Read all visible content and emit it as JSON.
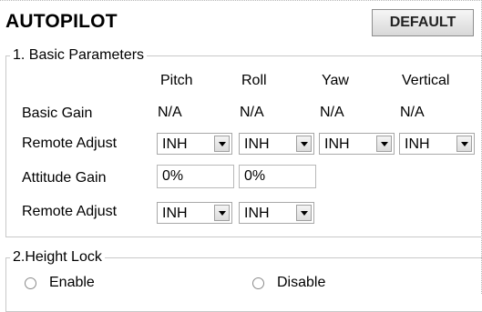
{
  "title": "AUTOPILOT",
  "default_label": "DEFAULT",
  "basic": {
    "legend": "1. Basic Parameters",
    "columns": [
      "Pitch",
      "Roll",
      "Yaw",
      "Vertical"
    ],
    "rows": {
      "basic_gain": {
        "label": "Basic Gain",
        "values": [
          "N/A",
          "N/A",
          "N/A",
          "N/A"
        ]
      },
      "remote_adjust_1": {
        "label": "Remote Adjust",
        "values": [
          "INH",
          "INH",
          "INH",
          "INH"
        ]
      },
      "attitude_gain": {
        "label": "Attitude Gain",
        "values": [
          "0%",
          "0%"
        ]
      },
      "remote_adjust_2": {
        "label": "Remote Adjust",
        "values": [
          "INH",
          "INH"
        ]
      }
    }
  },
  "height_lock": {
    "legend": "2.Height Lock",
    "enable_label": "Enable",
    "disable_label": "Disable"
  }
}
